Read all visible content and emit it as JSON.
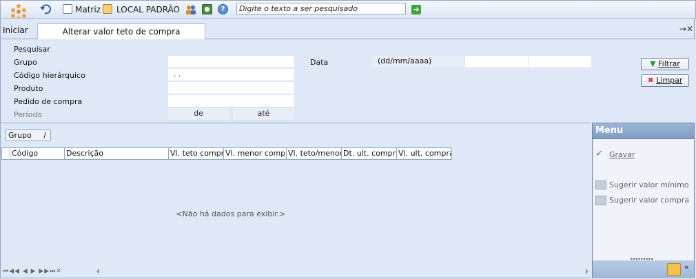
{
  "toolbar": {
    "company": "Matriz",
    "location": "LOCAL PADRÃO",
    "search_placeholder": "Digite o texto a ser pesquisado"
  },
  "tabs": {
    "home": "Iniciar",
    "active": "Alterar valor teto de compra",
    "close_glyph": "→✕"
  },
  "filter": {
    "title": "Pesquisar",
    "grupo": "Grupo",
    "codigo_hier": "Código hierárquico",
    "codigo_hier_value": ". .",
    "produto": "Produto",
    "pedido": "Pedido de compra",
    "periodo": "Período",
    "de": "de",
    "ate": "até",
    "data": "Data",
    "data_fmt": "(dd/mm/aaaa)"
  },
  "buttons": {
    "filtrar": "Filtrar",
    "limpar": "Limpar"
  },
  "grid": {
    "group_by": "Grupo",
    "group_sort": "/",
    "columns": [
      "Código",
      "Descrição",
      "Vl. teto compra",
      "Vl. menor compra",
      "Vl. teto/menor",
      "Dt. ult. compra",
      "Vl. ult. compra"
    ],
    "empty_text": "<Não há dados para exibir.>",
    "pager": "⏮◀◀ ◀ ▶ ▶▶⏭✕"
  },
  "menu": {
    "title": "Menu",
    "items": [
      "Gravar",
      "Sugerir valor mínimo",
      "Sugerir valor compra e..."
    ]
  }
}
